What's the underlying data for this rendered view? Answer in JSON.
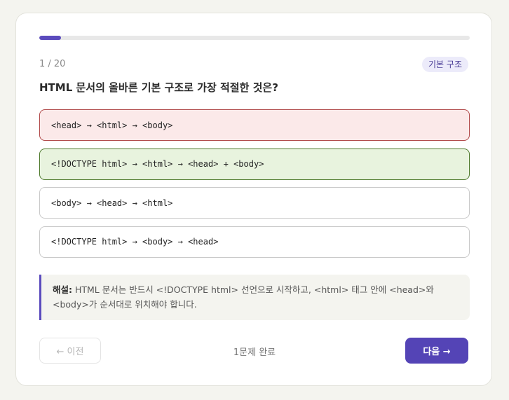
{
  "quiz": {
    "progress": 0.05,
    "counter": "1 / 20",
    "tag": "기본 구조",
    "question": "HTML 문서의 올바른 기본 구조로 가장 적절한 것은?",
    "options": [
      {
        "label": "<head> → <html> → <body>",
        "state": "wrong"
      },
      {
        "label": "<!DOCTYPE html> → <html> → <head> + <body>",
        "state": "correct"
      },
      {
        "label": "<body> → <head> → <html>",
        "state": "default"
      },
      {
        "label": "<!DOCTYPE html> → <body> → <head>",
        "state": "default"
      }
    ],
    "explanation": {
      "label": "해설:",
      "text": " HTML 문서는 반드시 <!DOCTYPE html> 선언으로 시작하고, <html> 태그 안에 <head>와 <body>가 순서대로 위치해야 합니다."
    }
  },
  "footer": {
    "prev_label": "← 이전",
    "status": "1문제 완료",
    "next_label": "다음 →"
  },
  "colors": {
    "accent": "#5444b6",
    "wrong_bg": "#fbe9e9",
    "wrong_border": "#b14a4a",
    "correct_bg": "#e8f3de",
    "correct_border": "#4e7a2c"
  }
}
